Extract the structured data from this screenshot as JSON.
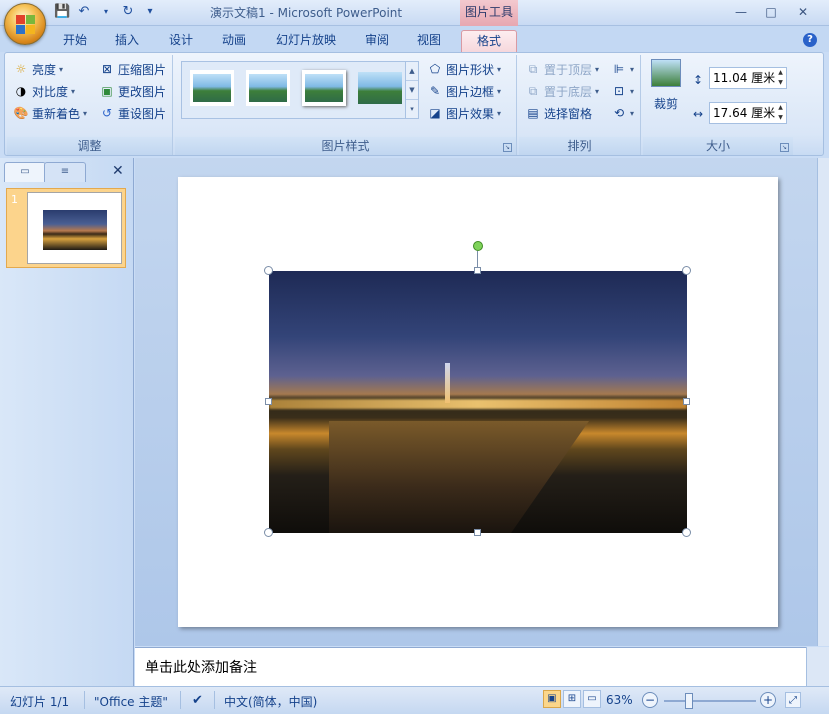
{
  "window": {
    "title": "演示文稿1 - Microsoft PowerPoint",
    "context_tab": "图片工具",
    "controls": {
      "minimize": "—",
      "maximize": "□",
      "close": "✕"
    }
  },
  "quick_access": {
    "save_icon": "save-icon",
    "undo_icon": "undo-icon",
    "redo_icon": "redo-icon",
    "customize": "▾"
  },
  "tabs": [
    "开始",
    "插入",
    "设计",
    "动画",
    "幻灯片放映",
    "审阅",
    "视图",
    "格式"
  ],
  "active_tab": "格式",
  "ribbon": {
    "adjust": {
      "label": "调整",
      "items": [
        "亮度",
        "对比度",
        "重新着色",
        "压缩图片",
        "更改图片",
        "重设图片"
      ]
    },
    "styles": {
      "label": "图片样式",
      "items": [
        "图片形状",
        "图片边框",
        "图片效果"
      ]
    },
    "arrange": {
      "label": "排列",
      "items": [
        "置于顶层",
        "置于底层",
        "选择窗格"
      ]
    },
    "size": {
      "label": "大小",
      "crop": "裁剪",
      "height": "11.04 厘米",
      "width": "17.64 厘米"
    }
  },
  "slide_panel": {
    "slide_number": "1"
  },
  "notes": {
    "placeholder": "单击此处添加备注"
  },
  "status": {
    "slide": "幻灯片 1/1",
    "theme": "\"Office 主题\"",
    "language": "中文(简体，中国)",
    "zoom": "63%"
  },
  "colors": {
    "ribbon_bg": "#d9e6f7",
    "context_tab": "#e7a7b1",
    "selected_thumb": "#fcd48c"
  }
}
